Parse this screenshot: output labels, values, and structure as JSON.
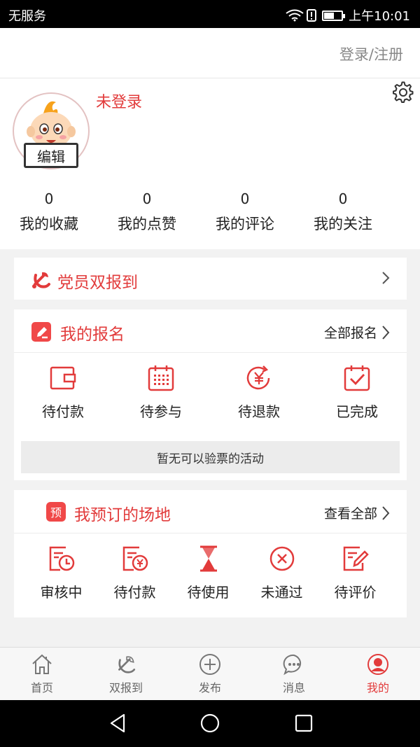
{
  "status_bar": {
    "carrier": "无服务",
    "time": "上午10:01",
    "battery_level": 0.55
  },
  "header": {
    "login_link": "登录/注册"
  },
  "profile": {
    "status": "未登录",
    "edit_label": "编辑"
  },
  "stats": [
    {
      "value": "0",
      "label": "我的收藏"
    },
    {
      "value": "0",
      "label": "我的点赞"
    },
    {
      "value": "0",
      "label": "我的评论"
    },
    {
      "value": "0",
      "label": "我的关注"
    }
  ],
  "party_card": {
    "title": "党员双报到"
  },
  "signup_card": {
    "title": "我的报名",
    "more": "全部报名",
    "items": [
      {
        "label": "待付款",
        "icon": "wallet-icon"
      },
      {
        "label": "待参与",
        "icon": "calendar-grid-icon"
      },
      {
        "label": "待退款",
        "icon": "refund-icon"
      },
      {
        "label": "已完成",
        "icon": "calendar-check-icon"
      }
    ],
    "notice": "暂无可以验票的活动"
  },
  "venue_card": {
    "title": "我预订的场地",
    "more": "查看全部",
    "badge": "预",
    "items": [
      {
        "label": "审核中",
        "icon": "doc-clock-icon"
      },
      {
        "label": "待付款",
        "icon": "doc-yen-icon"
      },
      {
        "label": "待使用",
        "icon": "hourglass-icon"
      },
      {
        "label": "未通过",
        "icon": "circle-x-icon"
      },
      {
        "label": "待评价",
        "icon": "doc-edit-icon"
      }
    ]
  },
  "tabbar": [
    {
      "label": "首页",
      "icon": "home-icon"
    },
    {
      "label": "双报到",
      "icon": "party-emblem-icon"
    },
    {
      "label": "发布",
      "icon": "plus-circle-icon"
    },
    {
      "label": "消息",
      "icon": "message-icon"
    },
    {
      "label": "我的",
      "icon": "user-icon",
      "active": true
    }
  ],
  "colors": {
    "accent": "#e23b3b",
    "text": "#222222",
    "muted": "#888888",
    "background": "#f2f2f2"
  }
}
